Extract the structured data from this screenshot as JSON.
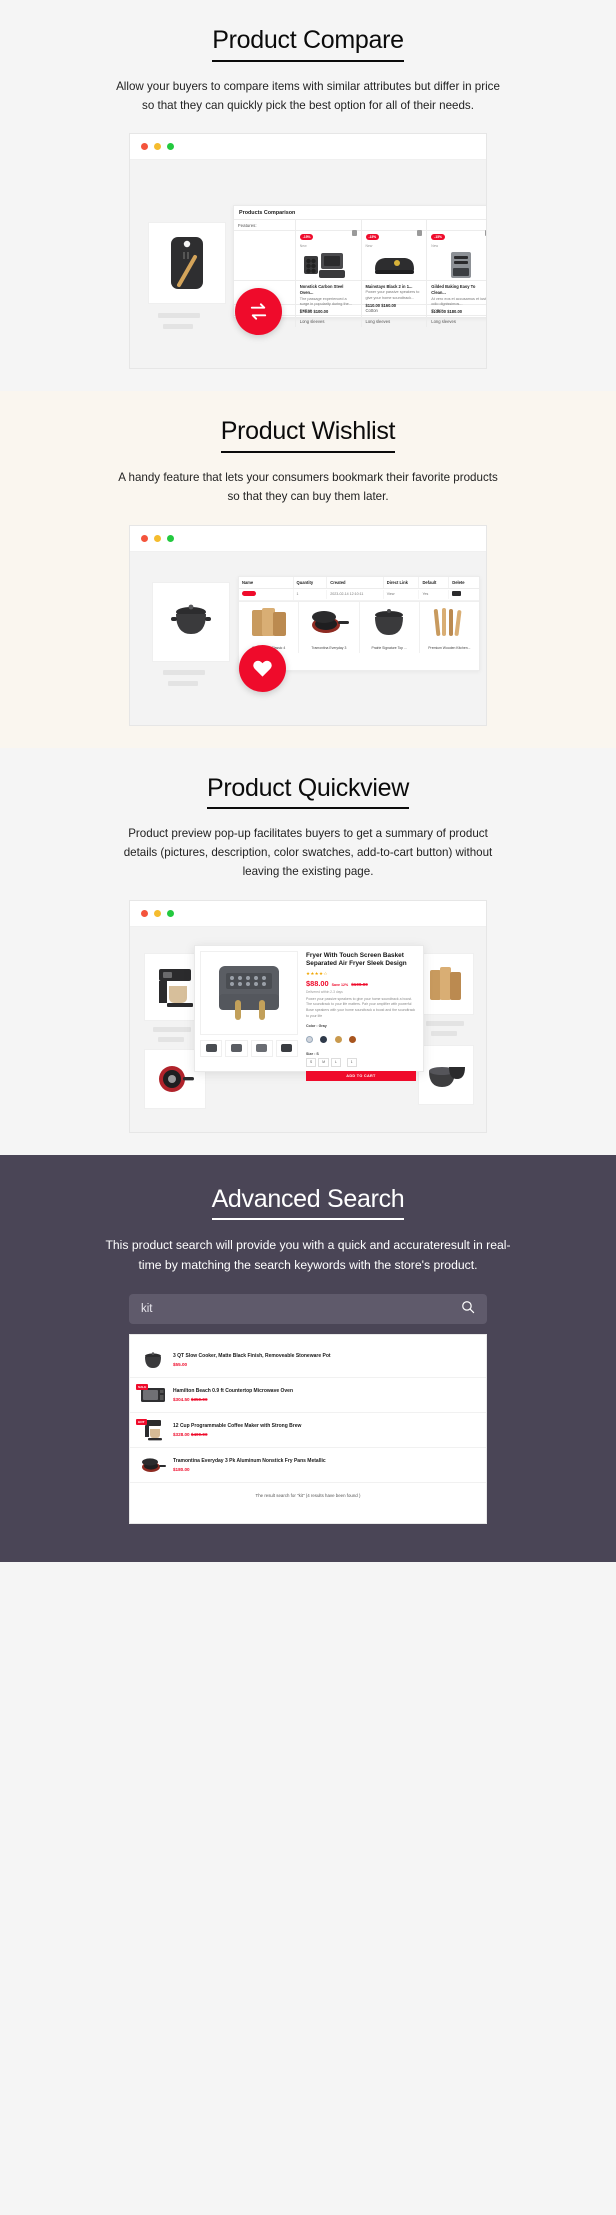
{
  "sections": [
    {
      "id": "compare",
      "title": "Product Compare",
      "description": "Allow your buyers to compare items with similar attributes but differ in price so that they can quickly pick the best option for all of their needs.",
      "fab_icon": "compare-arrows-icon",
      "panel_title": "Products Comparison",
      "features_label": "Features:",
      "columns": [
        {
          "badge": "-15%",
          "label_new": "New",
          "name": "Nonstick Carbon Steel Oven...",
          "text": "The passage experienced a surge in popularity during the...",
          "price": "$75.00",
          "old_price": "$100.00",
          "material": "Cotton",
          "sleeves": "Long sleeves"
        },
        {
          "badge": "-15%",
          "label_new": "New",
          "name": "Mainstays Black 2 in 1...",
          "text": "Power your passive speakers to give your home soundtrack...",
          "price": "$110.00",
          "old_price": "$160.00",
          "material": "Cotton",
          "sleeves": "Long sleeves"
        },
        {
          "badge": "-15%",
          "label_new": "New",
          "name": "Gilded Baking Easy To Clean...",
          "text": "At vero eos et accusamus et iusto odio dignissimos...",
          "price": "$136.00",
          "old_price": "$180.00",
          "material": "Cotton",
          "sleeves": "Long sleeves"
        }
      ]
    },
    {
      "id": "wishlist",
      "title": "Product Wishlist",
      "description": "A handy feature that lets your consumers bookmark their favorite products so that they can buy them later.",
      "fab_icon": "heart-icon",
      "headers": [
        "Name",
        "Quantity",
        "Created",
        "Direct Link",
        "Default",
        "Delete"
      ],
      "row": {
        "quantity": "1",
        "created": "2023-02-14 12:10:11",
        "direct_link": "View",
        "default": "Yes"
      },
      "products": [
        {
          "name": "Cutterpeace Classic 4"
        },
        {
          "name": "Tramontina Everyday 3"
        },
        {
          "name": "Prairie Signature Top ..."
        },
        {
          "name": "Premium Wooden Kitchen..."
        }
      ]
    },
    {
      "id": "quickview",
      "title": "Product Quickview",
      "description": "Product preview pop-up facilitates buyers to get a summary of product details (pictures, description, color swatches, add-to-cart button) without leaving the existing page.",
      "product": {
        "title": "Fryer With Touch Screen Basket Separated Air Fryer Sleek Design",
        "stars": "★★★★☆",
        "price": "$88.00",
        "save": "Save 12%",
        "old_price": "$100.00",
        "shipping": "Delivered within 2-3 days",
        "description": "Power your passive speakers to give your home soundtrack a boost. The soundtrack to your life matters. Pair your amplifier with powerful Bose speakers with your home soundtrack a boost and the soundtrack to your life",
        "color_label": "Color : Gray",
        "size_label": "Size : S",
        "sizes": [
          "S",
          "M",
          "L"
        ],
        "qty": "1",
        "cart_button": "ADD TO CART",
        "close_icon": "close-icon",
        "swatches": [
          "#cfd4dc",
          "#2f3a4a",
          "#c99a4e",
          "#a8551f"
        ]
      }
    },
    {
      "id": "search",
      "title": "Advanced Search",
      "description": "This product search will provide you with a quick and accurateresult in real-time by matching the search keywords with the store's product.",
      "search_value": "kit",
      "search_icon": "search-icon",
      "results": [
        {
          "name": "3 QT Slow Cooker, Matte Black Finish, Removeable Stoneware Pot",
          "price": "$55.00",
          "old_price": "",
          "tag": ""
        },
        {
          "name": "Hamilton Beach 0.9 ft Countertop Microwave Oven",
          "price": "$304.50",
          "old_price": "$350.00",
          "tag": "SALE"
        },
        {
          "name": "12 Cup Programmable Coffee Maker with Strong Brew",
          "price": "$328.00",
          "old_price": "$400.00",
          "tag": "HOT"
        },
        {
          "name": "Tramontina Everyday 3 Pk Aluminum Nonstick Fry Pans Metallic",
          "price": "$180.00",
          "old_price": "",
          "tag": ""
        }
      ],
      "footer": "The result search for \"kit\" (4 results have been found )"
    }
  ],
  "colors": {
    "accent": "#ef0b2b",
    "search_bg": "#4a4556",
    "wishlist_bg": "#faf6ef",
    "page_bg": "#f5f5f5"
  }
}
